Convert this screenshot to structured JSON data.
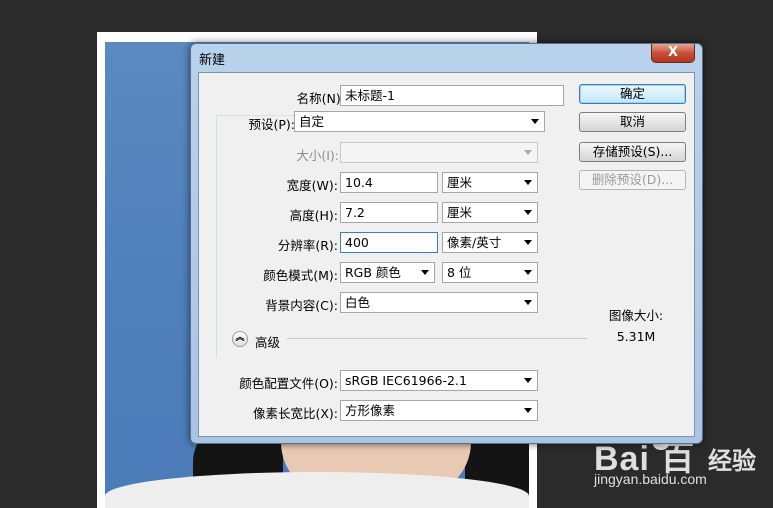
{
  "dialog": {
    "title": "新建",
    "close_glyph": "X"
  },
  "fields": {
    "name_label": "名称(N):",
    "name_value": "未标题-1",
    "preset_label": "预设(P):",
    "preset_value": "自定",
    "size_label": "大小(I):",
    "size_value": "",
    "width_label": "宽度(W):",
    "width_value": "10.4",
    "width_unit": "厘米",
    "height_label": "高度(H):",
    "height_value": "7.2",
    "height_unit": "厘米",
    "resolution_label": "分辨率(R):",
    "resolution_value": "400",
    "resolution_unit": "像素/英寸",
    "color_mode_label": "颜色模式(M):",
    "color_mode_value": "RGB 颜色",
    "bit_depth_value": "8 位",
    "background_label": "背景内容(C):",
    "background_value": "白色",
    "advanced_label": "高级",
    "color_profile_label": "颜色配置文件(O):",
    "color_profile_value": "sRGB IEC61966-2.1",
    "pixel_aspect_label": "像素长宽比(X):",
    "pixel_aspect_value": "方形像素"
  },
  "buttons": {
    "ok": "确定",
    "cancel": "取消",
    "save_preset": "存储预设(S)...",
    "delete_preset": "删除预设(D)..."
  },
  "image_size": {
    "label": "图像大小:",
    "value": "5.31M"
  },
  "watermark": {
    "logo_text": "Bai  百",
    "jingyan": "经验",
    "url": "jingyan.baidu.com"
  },
  "colors": {
    "photo_background": "#4f80bc",
    "dialog_frame": "#a9c5e4",
    "default_button_border": "#3c7fb1"
  }
}
